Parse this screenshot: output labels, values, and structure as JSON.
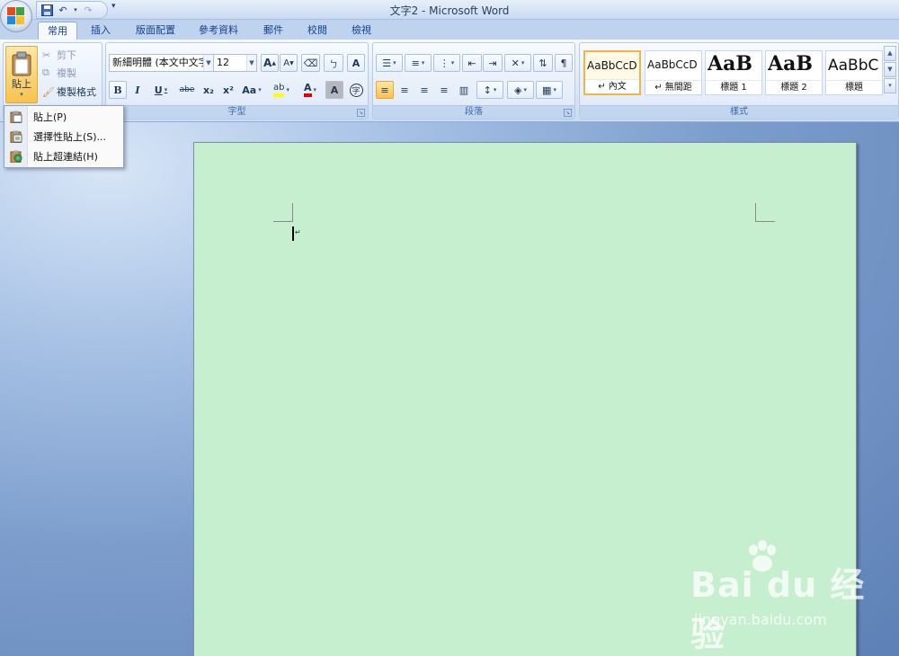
{
  "window": {
    "title": "文字2 - Microsoft Word"
  },
  "quick_access": {
    "icons": [
      "save-icon",
      "undo-icon",
      "redo-icon"
    ],
    "more": "▾"
  },
  "tabs": [
    {
      "label": "常用",
      "active": true
    },
    {
      "label": "插入"
    },
    {
      "label": "版面配置"
    },
    {
      "label": "參考資料"
    },
    {
      "label": "郵件"
    },
    {
      "label": "校閱"
    },
    {
      "label": "檢視"
    }
  ],
  "clipboard": {
    "paste_label": "貼上",
    "cut_label": "剪下",
    "copy_label": "複製",
    "format_painter_label": "複製格式"
  },
  "font": {
    "name": "新細明體 (本文中文字",
    "size": "12",
    "group_label": "字型",
    "bold": "B",
    "italic": "I",
    "underline": "U",
    "strike": "abe",
    "subscript": "x₂",
    "superscript": "x²",
    "change_case": "Aa",
    "grow": "A",
    "shrink": "A"
  },
  "paragraph": {
    "group_label": "段落"
  },
  "styles": {
    "group_label": "樣式",
    "items": [
      {
        "sample": "AaBbCcD",
        "name": "↵ 內文",
        "active": true
      },
      {
        "sample": "AaBbCcD",
        "name": "↵ 無間距"
      },
      {
        "sample": "AaB",
        "name": "標題 1"
      },
      {
        "sample": "AaB",
        "name": "標題 2"
      },
      {
        "sample": "AaBbC",
        "name": "標題"
      }
    ]
  },
  "paste_menu": {
    "items": [
      {
        "label": "貼上(P)"
      },
      {
        "label": "選擇性貼上(S)..."
      },
      {
        "label": "貼上超連結(H)"
      }
    ]
  },
  "document": {
    "paragraph_mark": "↵"
  },
  "watermark": {
    "main": "Bai du 经验",
    "sub": "jingyan.baidu.com"
  },
  "colors": {
    "page_bg": "#c6efd0",
    "accent": "#f8c24f",
    "font_color": "#e00000",
    "highlight": "#ffff00"
  }
}
